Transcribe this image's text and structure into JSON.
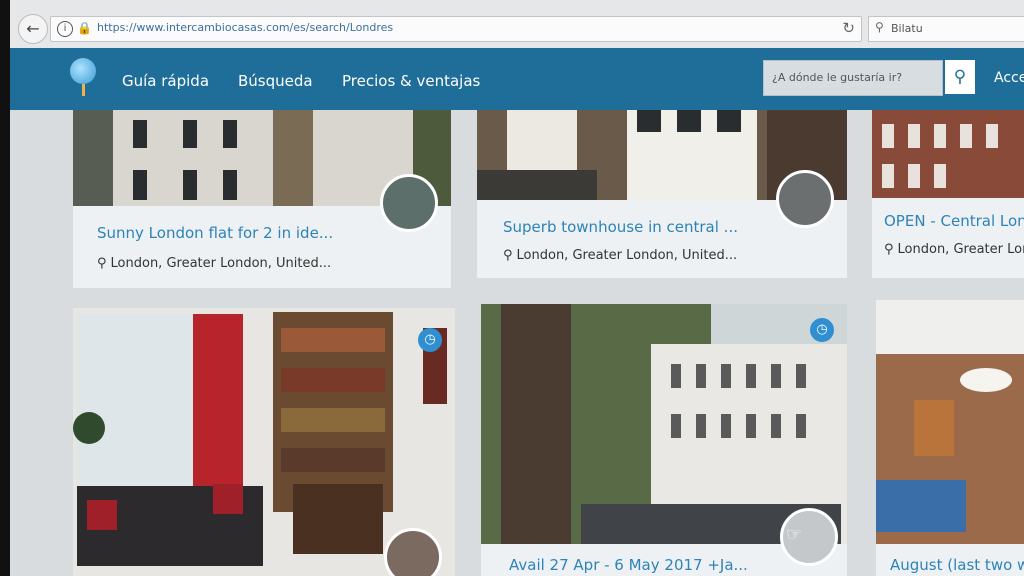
{
  "browser": {
    "url": "https://www.intercambiocasas.com/es/search/Londres",
    "search_text": "Bilatu"
  },
  "header": {
    "nav": [
      "Guía rápida",
      "Búsqueda",
      "Precios & ventajas"
    ],
    "destination_placeholder": "¿A dónde le gustaría ir?",
    "access_label": "Acce"
  },
  "listings": [
    {
      "title": "Sunny London flat for 2 in ide...",
      "location": "London, Greater London, United..."
    },
    {
      "title": "Superb townhouse in central ...",
      "location": "London, Greater London, United..."
    },
    {
      "title": "OPEN - Central Lon",
      "location": "London, Greater Lon"
    },
    {
      "title": "",
      "location": ""
    },
    {
      "title": "Avail 27 Apr - 6 May 2017 +Ja...",
      "location": ""
    },
    {
      "title": "August (last two we",
      "location": ""
    }
  ],
  "icons": {
    "back": "back-arrow-icon",
    "info": "info-icon",
    "lock": "lock-icon",
    "reload": "reload-icon",
    "search": "search-icon",
    "pin": "map-pin-icon",
    "clock": "clock-icon"
  },
  "colors": {
    "header": "#1f6e9a",
    "title_link": "#2d83b8",
    "badge": "#2f8fd0"
  }
}
